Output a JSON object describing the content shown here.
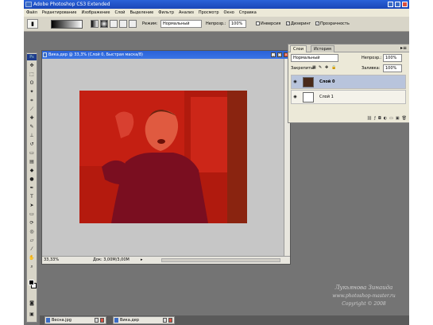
{
  "app": {
    "title": "Adobe Photoshop CS3 Extended"
  },
  "menu": [
    "Файл",
    "Редактирование",
    "Изображение",
    "Слой",
    "Выделение",
    "Фильтр",
    "Анализ",
    "Просмотр",
    "Окно",
    "Справка"
  ],
  "options": {
    "mode_label": "Режим:",
    "mode_value": "Нормальный",
    "opacity_label": "Непрозр.:",
    "opacity_value": "100%",
    "inverse_label": "Инверсия",
    "dither_label": "Дизеринг",
    "transparency_label": "Прозрачность"
  },
  "document": {
    "title": "Вика.дер @ 33,3% (Слой 0, Быстрая маска/8)",
    "zoom": "33,33%",
    "doc_info": "Док: 3,00М/3,00М"
  },
  "layers_panel": {
    "tab_layers": "Слои",
    "tab_history": "История",
    "blend_mode": "Нормальный",
    "opacity_label": "Непрозр.:",
    "opacity_value": "100%",
    "lock_label": "Закрепить:",
    "fill_label": "Заливка:",
    "fill_value": "100%",
    "layers": [
      {
        "name": "Слой 0"
      },
      {
        "name": "Слой 1"
      }
    ]
  },
  "watermark": {
    "author": "Лукьянова Зинаида",
    "site": "www.photoshop-master.ru",
    "copyright": "Copyright © 2008"
  },
  "taskbar": {
    "items": [
      "Весна.jpg",
      "Вика.дер"
    ]
  },
  "colors": {
    "foreground": "#000000",
    "background": "#ffffff",
    "quick_mask": "#c01c10"
  }
}
